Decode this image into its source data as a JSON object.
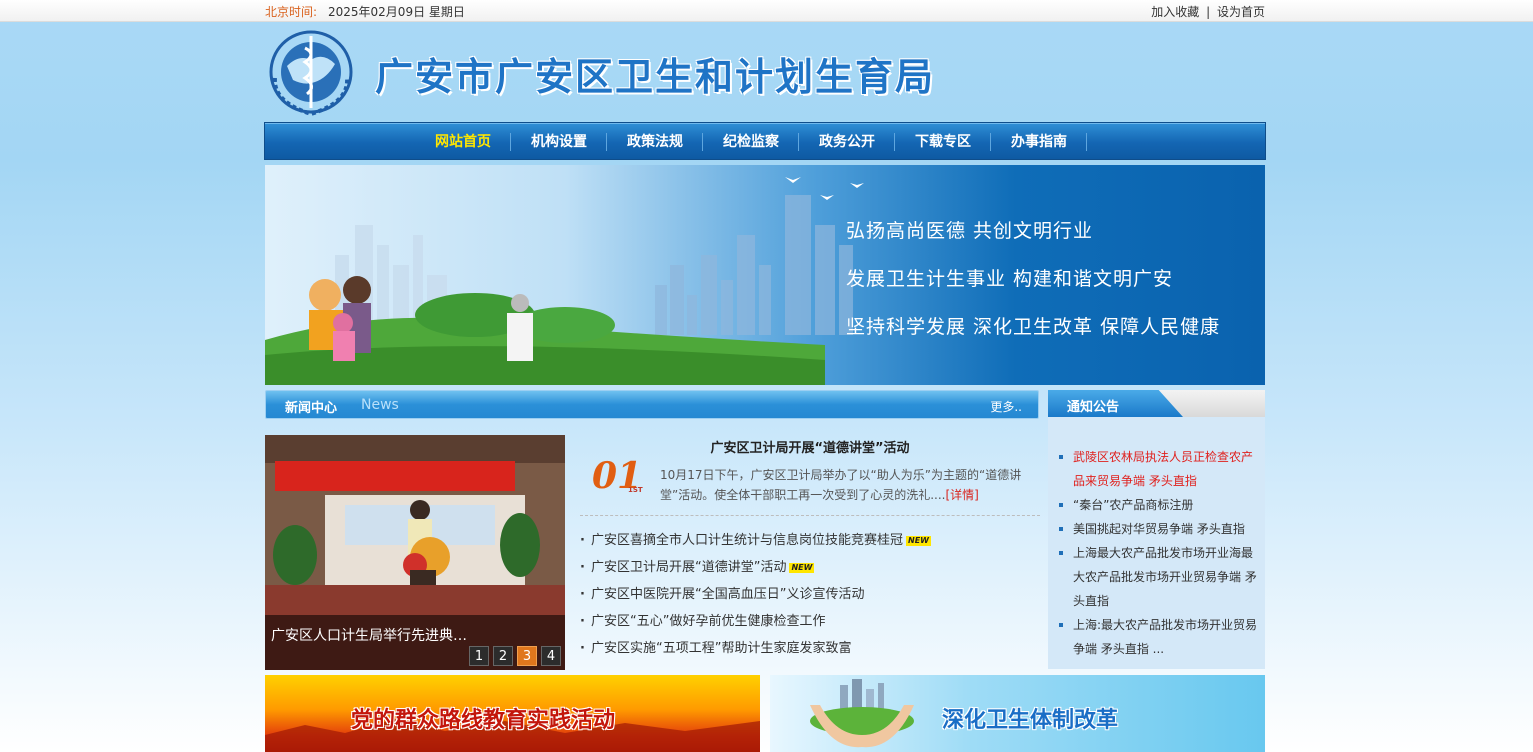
{
  "topbar": {
    "date_label": "北京时间:",
    "date_value": "2025年02月09日 星期日",
    "bookmark": "加入收藏",
    "separator": "|",
    "homepage": "设为首页"
  },
  "header": {
    "site_title": "广安市广安区卫生和计划生育局"
  },
  "nav": {
    "items": [
      "网站首页",
      "机构设置",
      "政策法规",
      "纪检监察",
      "政务公开",
      "下载专区",
      "办事指南"
    ]
  },
  "banner": {
    "slogans": [
      "弘扬高尚医德  共创文明行业",
      "发展卫生计生事业  构建和谐文明广安",
      "坚持科学发展  深化卫生改革  保障人民健康"
    ]
  },
  "news": {
    "title": "新闻中心",
    "subtitle": "News",
    "more": "更多..",
    "photo_caption": "广安区人口计生局举行先进典…",
    "pager": [
      "1",
      "2",
      "3",
      "4"
    ],
    "pager_active": "3",
    "headline": {
      "number": "01",
      "number_suffix": "1ST",
      "title": "广安区卫计局开展“道德讲堂”活动",
      "summary": "10月17日下午，广安区卫计局举办了以“助人为乐”为主题的“道德讲堂”活动。使全体干部职工再一次受到了心灵的洗礼....",
      "detail_link": "[详情]"
    },
    "new_tag": "NEW",
    "list": [
      "广安区喜摘全市人口计生统计与信息岗位技能竞赛桂冠",
      "广安区卫计局开展“道德讲堂”活动",
      "广安区中医院开展“全国高血压日”义诊宣传活动",
      "广安区“五心”做好孕前优生健康检查工作",
      "广安区实施“五项工程”帮助计生家庭发家致富"
    ]
  },
  "notice": {
    "title": "通知公告",
    "items": [
      "武陵区农林局执法人员正检查农产品来贸易争端 矛头直指",
      "“秦台”农产品商标注册",
      "美国挑起对华贸易争端 矛头直指",
      "上海最大农产品批发市场开业海最大农产品批发市场开业贸易争端 矛头直指",
      "上海:最大农产品批发市场开业贸易争端 矛头直指 ..."
    ]
  },
  "bottom_banners": {
    "left": "党的群众路线教育实践活动",
    "right": "深化卫生体制改革"
  },
  "colors": {
    "nav_active": "#ffe600",
    "date_label": "#d9621e",
    "hot_notice": "#e0211e",
    "brand_blue": "#1f74c6"
  }
}
